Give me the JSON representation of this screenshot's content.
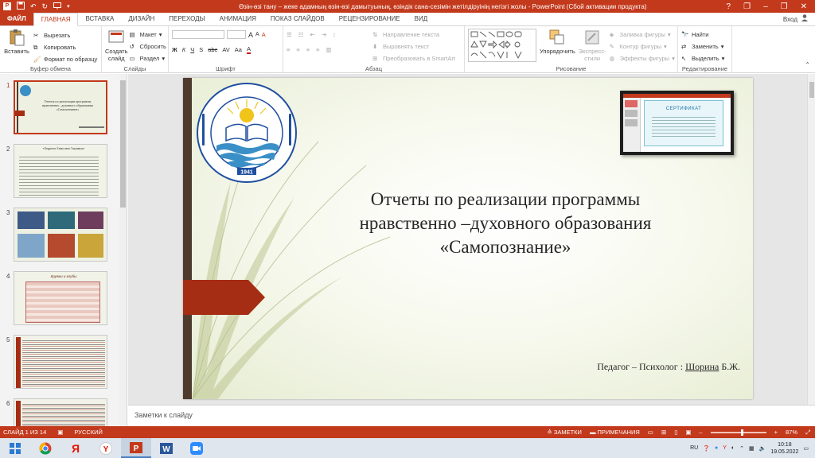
{
  "window": {
    "title": "Өзін-өзі тану – жеке адамның өзін-өзі дамытуының, өзіндік сана-сезімін жетілдіруінің негізгі жолы - PowerPoint (Сбой активации продукта)",
    "controls": [
      "?",
      "❐",
      "–",
      "❐",
      "✕"
    ]
  },
  "tabs": [
    {
      "label": "ФАЙЛ",
      "kind": "file"
    },
    {
      "label": "ГЛАВНАЯ",
      "kind": "active"
    },
    {
      "label": "ВСТАВКА"
    },
    {
      "label": "ДИЗАЙН"
    },
    {
      "label": "ПЕРЕХОДЫ"
    },
    {
      "label": "АНИМАЦИЯ"
    },
    {
      "label": "ПОКАЗ СЛАЙДОВ"
    },
    {
      "label": "РЕЦЕНЗИРОВАНИЕ"
    },
    {
      "label": "ВИД"
    }
  ],
  "signin": "Вход",
  "ribbon": {
    "clipboard": {
      "label": "Буфер обмена",
      "paste": "Вставить",
      "cut": "Вырезать",
      "copy": "Копировать",
      "format": "Формат по образцу"
    },
    "slides": {
      "label": "Слайды",
      "new_slide": "Создать слайд",
      "layout": "Макет",
      "reset": "Сбросить",
      "section": "Раздел"
    },
    "font": {
      "label": "Шрифт",
      "bold": "Ж",
      "italic": "К",
      "underline": "Ч",
      "strike": "S",
      "shadow": "abc",
      "spacing": "AV",
      "case": "Aa",
      "grow": "A",
      "shrink": "A",
      "clear": "A",
      "color": "A"
    },
    "paragraph": {
      "label": "Абзац",
      "direction": "Направление текста",
      "align": "Выровнять текст",
      "smartart": "Преобразовать в SmartArt"
    },
    "drawing": {
      "label": "Рисование",
      "arrange": "Упорядочить",
      "quick_styles": "Экспресс-стили",
      "fill": "Заливка фигуры",
      "outline": "Контур фигуры",
      "effects": "Эффекты фигуры"
    },
    "editing": {
      "label": "Редактирование",
      "find": "Найти",
      "replace": "Заменить",
      "select": "Выделить"
    }
  },
  "thumbnails": [
    {
      "num": "1",
      "selected": true,
      "title": "Отчеты по реализации программы нравственно –духовного образования «Самопознание»"
    },
    {
      "num": "2",
      "selected": false,
      "title": "«Педагоги Ўзіміз мен Тақтамыз»"
    },
    {
      "num": "3",
      "selected": false,
      "title": ""
    },
    {
      "num": "4",
      "selected": false,
      "title": "Кружки и клубы"
    },
    {
      "num": "5",
      "selected": false,
      "title": ""
    },
    {
      "num": "6",
      "selected": false,
      "title": ""
    }
  ],
  "slide": {
    "title_lines": [
      "Отчеты по реализации программы",
      "нравственно –духовного образования",
      "«Самопознание»"
    ],
    "subtitle_prefix": "Педагог – Психолог : ",
    "subtitle_name": "Шорина",
    "subtitle_suffix": " Б.Ж.",
    "logo_year": "1941",
    "certificate_word": "СЕРТИФИКАТ",
    "colors": {
      "accent": "#c3391c",
      "arrow": "#a52d14",
      "bar": "#4f3b2e"
    }
  },
  "notes": {
    "placeholder": "Заметки к слайду"
  },
  "status": {
    "slide_info": "СЛАЙД 1 ИЗ 14",
    "language": "РУССКИЙ",
    "notes_btn": "ЗАМЕТКИ",
    "comments_btn": "ПРИМЕЧАНИЯ",
    "zoom": "87%",
    "zoom_level": 0.58
  },
  "taskbar": {
    "apps": [
      "windows-start",
      "chrome",
      "yandex",
      "yandex-browser",
      "powerpoint",
      "word",
      "zoom"
    ],
    "lang": "RU",
    "time": "10:18",
    "date": "19.05.2022"
  }
}
